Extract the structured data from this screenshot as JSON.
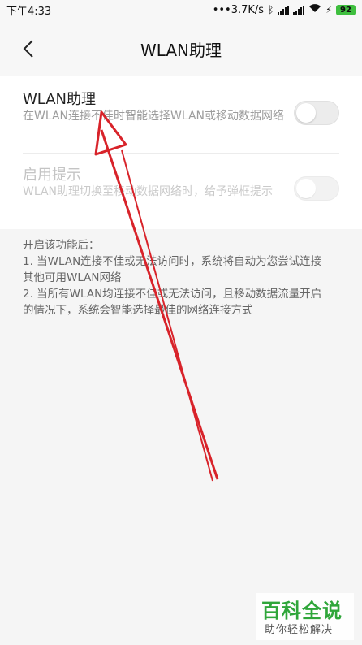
{
  "status_bar": {
    "time": "下午4:33",
    "network_speed": "•••3.7K/s",
    "battery_level": "92",
    "icons": [
      "bluetooth-icon",
      "signal-icon",
      "signal-icon",
      "wifi-icon",
      "charging-icon",
      "battery-icon"
    ]
  },
  "header": {
    "back_icon": "chevron-left-icon",
    "title": "WLAN助理"
  },
  "settings": {
    "wlan_assistant": {
      "title": "WLAN助理",
      "subtitle": "在WLAN连接不佳时智能选择WLAN或移动数据网络",
      "enabled": false
    },
    "enable_prompt": {
      "title": "启用提示",
      "subtitle": "WLAN助理切换至移动数据网络时，给予弹框提示",
      "enabled": false,
      "disabled": true
    }
  },
  "info": {
    "heading": "开启该功能后：",
    "lines": [
      "1. 当WLAN连接不佳或无法访问时，系统将自动为您尝试连接",
      "其他可用WLAN网络",
      "2. 当所有WLAN均连接不佳或无法访问，且移动数据流量开启",
      "的情况下，系统会智能选择最佳的网络连接方式"
    ]
  },
  "annotation": {
    "color": "#d8232a"
  },
  "watermark": {
    "title": "百科全说",
    "subtitle": "助你轻松解决",
    "color": "#2fa63a"
  }
}
